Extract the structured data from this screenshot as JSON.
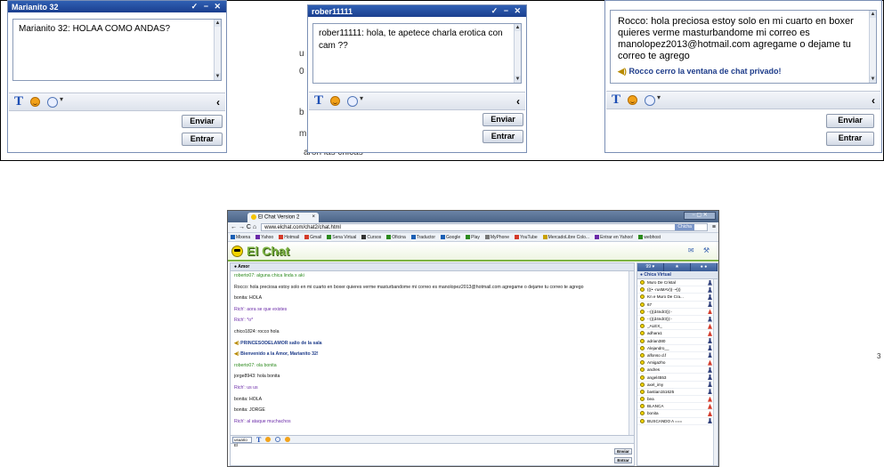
{
  "windows": [
    {
      "title": "Marianito 32",
      "controls": "✓ − ✕",
      "messages": [
        "Marianito 32: HOLAA COMO ANDAS?"
      ],
      "send_label": "Enviar",
      "enter_label": "Entrar"
    },
    {
      "title": "rober11111",
      "controls": "✓ − ✕",
      "messages": [
        "rober11111: hola, te apetece charla erotica con cam ??"
      ],
      "send_label": "Enviar",
      "enter_label": "Entrar"
    },
    {
      "title": "",
      "controls": "",
      "messages": [
        "Rocco: hola preciosa estoy solo en mi cuarto en boxer quieres verme masturbandome mi correo es manolopez2013@hotmail.com agregame o dejame tu correo te agrego"
      ],
      "system_message": "Rocco cerro la ventana de chat privado!",
      "send_label": "Enviar",
      "enter_label": "Entrar"
    }
  ],
  "background_fragments": {
    "u": "u",
    "zero": "0",
    "b": "b",
    "m": "m",
    "chicas": "aron las chicas",
    "right_mark": "3"
  },
  "browser": {
    "tab_title": "El Chat Version 2",
    "tab_close": "×",
    "nav": "← → C ⌂",
    "url": "www.elchat.com/chat2/chat.html",
    "url_pill": "Chicha",
    "bookmarks": [
      "Mixena",
      "Yahoo",
      "Hotmail",
      "Gmail",
      "Sena Virtual",
      "Cursos",
      "Oficina",
      "Traductor",
      "Google",
      "Play",
      "MyPhone",
      "YouTube",
      "MercadoLibre Colo...",
      "Entrar en Yahoo!",
      "webhost"
    ],
    "logo_text": "El Chat",
    "room_tab": "Amor",
    "messages": [
      {
        "text": "roberto07: alguna chica linda x aki",
        "style": "green"
      },
      {
        "text": "Rocco: hola preciosa estoy solo en mi cuarto en boxer quieres verme masturbandome mi correo es manolopez2013@hotmail.com agregame o dejame tu correo te agrego",
        "style": "black"
      },
      {
        "text": "bonita: HOLA",
        "style": "black"
      },
      {
        "text": "Rich': aora se que existes",
        "style": "purple"
      },
      {
        "text": "Rich': *o*",
        "style": "purple"
      },
      {
        "text": "chico1824: rocco hola",
        "style": "black"
      },
      {
        "text": "PRINCESODELAMOR salio de la sala",
        "style": "sys"
      },
      {
        "text": "Bienvenido a la Amor, Marianito 32!",
        "style": "sys"
      },
      {
        "text": "roberto07: ola bonita",
        "style": "green"
      },
      {
        "text": "jorge8943: hola bonita",
        "style": "black"
      },
      {
        "text": "Rich': us us",
        "style": "purple"
      },
      {
        "text": "bonita: HOLA",
        "style": "black"
      },
      {
        "text": "bonita: JORGE",
        "style": "black"
      },
      {
        "text": "Rich': al ataque muchachos",
        "style": "purple"
      }
    ],
    "user_select": "usuario El",
    "send_label": "Enviar",
    "enter_label": "Entrar",
    "user_tabs": [
      "99 ♥",
      "★",
      "● ●"
    ],
    "room_name": "Chica Virtual",
    "users": [
      {
        "name": "Muro De Cristal",
        "g": "m"
      },
      {
        "name": "(((•··rusMAV))··•)))",
        "g": "m"
      },
      {
        "name": "Kn e Muro De Cra...",
        "g": "m"
      },
      {
        "name": "67",
        "g": "m"
      },
      {
        "name": "-·(((d4ndr3)):-",
        "g": "f"
      },
      {
        "name": "-·(((d4ndr3)):-",
        "g": "m"
      },
      {
        "name": "_ALEX_",
        "g": "f"
      },
      {
        "name": "adhara1",
        "g": "f"
      },
      {
        "name": "adrian380",
        "g": "m"
      },
      {
        "name": "Alejandro__",
        "g": "m"
      },
      {
        "name": "alfonso d.f",
        "g": "m"
      },
      {
        "name": "Amigazho",
        "g": "f"
      },
      {
        "name": "andres",
        "g": "m"
      },
      {
        "name": "angel4553",
        "g": "m"
      },
      {
        "name": "axel_imy",
        "g": "m"
      },
      {
        "name": "bastian151625",
        "g": "m"
      },
      {
        "name": "bea",
        "g": "f"
      },
      {
        "name": "BLANCA",
        "g": "f"
      },
      {
        "name": "bonita",
        "g": "f"
      },
      {
        "name": "BUSCANDO A ===",
        "g": "m"
      }
    ]
  },
  "colors": {
    "title_blue": "#1b3f8f",
    "logo_green": "#7cb342"
  }
}
